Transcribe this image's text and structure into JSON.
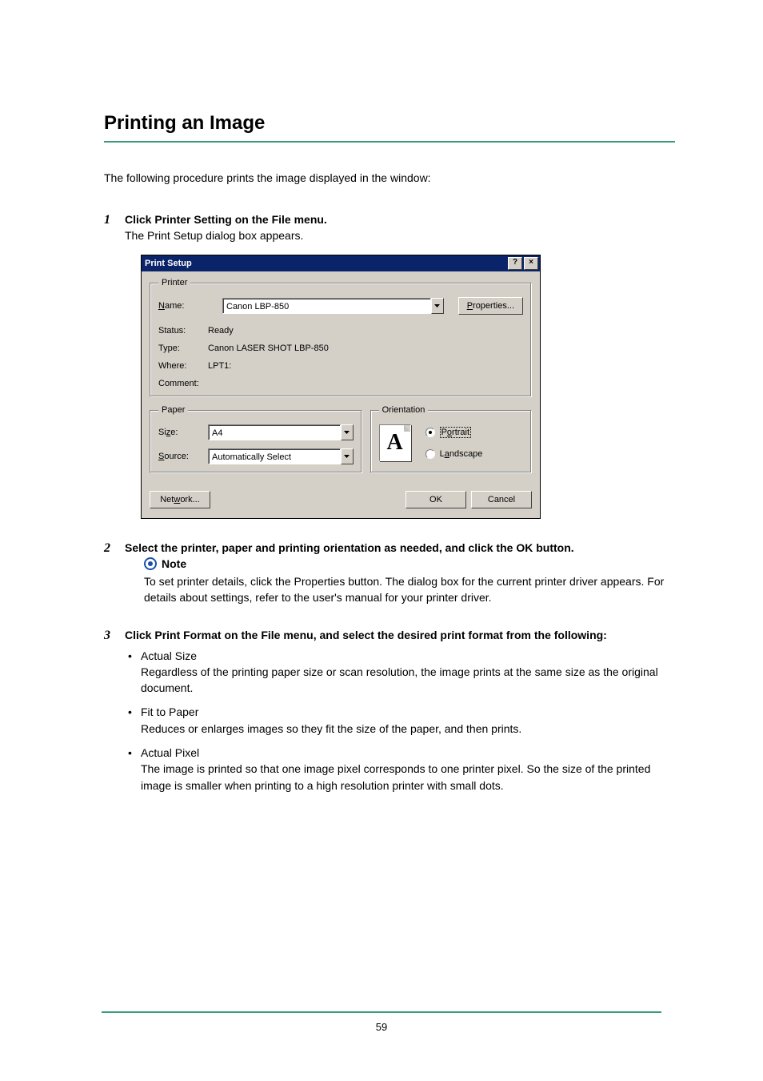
{
  "page": {
    "title": "Printing an Image",
    "intro": "The following procedure prints the image displayed in the window:",
    "number": "59"
  },
  "steps": {
    "s1": {
      "title": "Click Printer Setting on the File menu.",
      "body": "The Print Setup dialog box appears."
    },
    "s2": {
      "title": "Select the printer, paper and printing orientation as needed, and click the OK button."
    },
    "s3": {
      "title": "Click Print Format on the File menu, and select the desired print format from the following:"
    }
  },
  "dialog": {
    "title": "Print Setup",
    "help_btn": "?",
    "close_btn": "×",
    "printer": {
      "legend": "Printer",
      "name_label_pre": "N",
      "name_label_post": "ame:",
      "name_value": "Canon LBP-850",
      "properties_pre": "P",
      "properties_post": "roperties...",
      "status_label": "Status:",
      "status_value": "Ready",
      "type_label": "Type:",
      "type_value": "Canon LASER SHOT LBP-850",
      "where_label": "Where:",
      "where_value": "LPT1:",
      "comment_label": "Comment:",
      "comment_value": ""
    },
    "paper": {
      "legend": "Paper",
      "size_label_pre": "Si",
      "size_label_ul": "z",
      "size_label_post": "e:",
      "size_value": "A4",
      "source_label_ul": "S",
      "source_label_post": "ource:",
      "source_value": "Automatically Select"
    },
    "orientation": {
      "legend": "Orientation",
      "icon_letter": "A",
      "portrait_pre": "P",
      "portrait_ul": "o",
      "portrait_post": "rtrait",
      "landscape_pre": "L",
      "landscape_ul": "a",
      "landscape_post": "ndscape"
    },
    "footer": {
      "network_pre": "Net",
      "network_ul": "w",
      "network_post": "ork...",
      "ok": "OK",
      "cancel": "Cancel"
    }
  },
  "note": {
    "heading": "Note",
    "body": "To set printer details, click the Properties button. The dialog box for the current printer driver appears. For details about settings, refer to the user's manual for your printer driver."
  },
  "formats": {
    "f1": {
      "name": "Actual Size",
      "desc": "Regardless of the printing paper size or scan resolution, the image prints at the same size as the original document."
    },
    "f2": {
      "name": "Fit to Paper",
      "desc": "Reduces or enlarges images so they fit the size of the paper, and then prints."
    },
    "f3": {
      "name": "Actual Pixel",
      "desc": "The image is printed so that one image pixel corresponds to one printer pixel. So the size of the printed image is smaller when printing to a high resolution printer with small dots."
    }
  }
}
